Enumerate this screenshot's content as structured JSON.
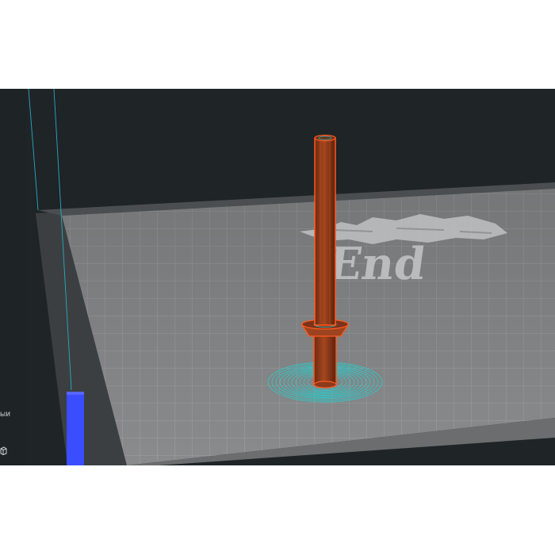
{
  "app": {
    "left_panel": {
      "partial_label": "ыи",
      "icon": "cube-icon"
    },
    "viewport": {
      "bed_logo_text": "End",
      "colors": {
        "background": "#1f2427",
        "bed": "#8a8c8d",
        "bed_grid": "#a3a5a6",
        "model_body": "#8b3a1c",
        "model_outline": "#ff5a1f",
        "skirt": "#2fc7c7",
        "layer_slider": "#3a4dff",
        "guide_line": "#2aa9c0"
      },
      "icons": [
        "ender-logo",
        "layer-slider-handle"
      ]
    }
  }
}
